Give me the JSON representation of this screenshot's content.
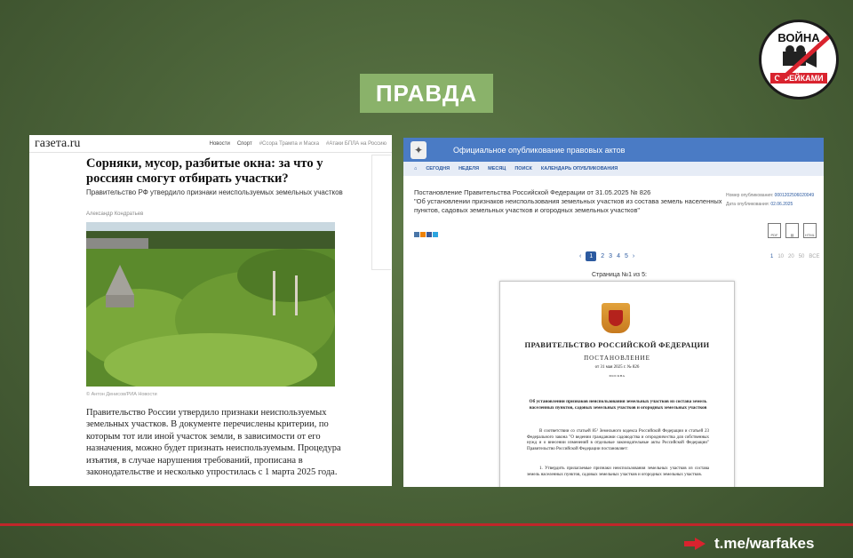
{
  "badge": {
    "label": "ПРАВДА"
  },
  "logo": {
    "top": "ВОЙНА",
    "bottom": "С ФЕЙКАМИ"
  },
  "left_article": {
    "site_logo": "газета.ru",
    "nav": [
      "Новости",
      "Спорт",
      "#Ссора Трампа и Маска",
      "#Атаки БПЛА на Россию"
    ],
    "title": "Сорняки, мусор, разбитые окна: за что у россиян смогут отбирать участки?",
    "subtitle": "Правительство РФ утвердило признаки неиспользуемых земельных участков",
    "author": "Александр Кондратьев",
    "photo_caption": "© Антон Денисов/РИА Новости",
    "body": "Правительство России утвердило признаки неиспользуемых земельных участков. В документе перечислены критерии, по которым тот или иной участок земли, в зависимости от его назначения, можно будет признать неиспользуемым. Процедура изъятия, в случае нарушения требований, прописана в законодательстве и несколько упростилась с 1 марта 2025 года."
  },
  "right_article": {
    "header_title": "Официальное опубликование правовых актов",
    "nav": [
      "СЕГОДНЯ",
      "НЕДЕЛЯ",
      "МЕСЯЦ",
      "ПОИСК",
      "КАЛЕНДАРЬ ОПУБЛИКОВАНИЯ"
    ],
    "doc_title": "Постановление Правительства Российской Федерации от 31.05.2025 № 826",
    "doc_subtitle": "\"Об установлении признаков неиспользования земельных участков из состава земель населенных пунктов, садовых земельных участков и огородных земельных участков\"",
    "meta_number_label": "Номер опубликования:",
    "meta_number": "0001202506020049",
    "meta_date_label": "Дата опубликования:",
    "meta_date": "02.06.2025",
    "file_icons": [
      "pdf-icon",
      "print-icon",
      "html-icon"
    ],
    "pages": [
      "1",
      "2",
      "3",
      "4",
      "5"
    ],
    "per_page": [
      "1",
      "10",
      "20",
      "50",
      "ВСЕ"
    ],
    "page_label": "Страница №1 из 5:",
    "paper": {
      "gov": "ПРАВИТЕЛЬСТВО РОССИЙСКОЙ ФЕДЕРАЦИИ",
      "post": "ПОСТАНОВЛЕНИЕ",
      "date": "от 31 мая 2025 г. № 826",
      "city": "МОСКВА",
      "heading": "Об установлении признаков неиспользования земельных участков из состава земель населенных пунктов, садовых земельных участков и огородных земельных участков",
      "p1": "В соответствии со статьей 85¹ Земельного кодекса Российской Федерации и статьей 23 Федерального закона \"О ведении гражданами садоводства и огородничества для собственных нужд и о внесении изменений в отдельные законодательные акты Российской Федерации\" Правительство Российской Федерации постановляет:",
      "p2": "1. Утвердить прилагаемые признаки неиспользования земельных участков из состава земель населенных пунктов, садовых земельных участков и огородных земельных участков."
    }
  },
  "footer": {
    "link": "t.me/warfakes"
  }
}
